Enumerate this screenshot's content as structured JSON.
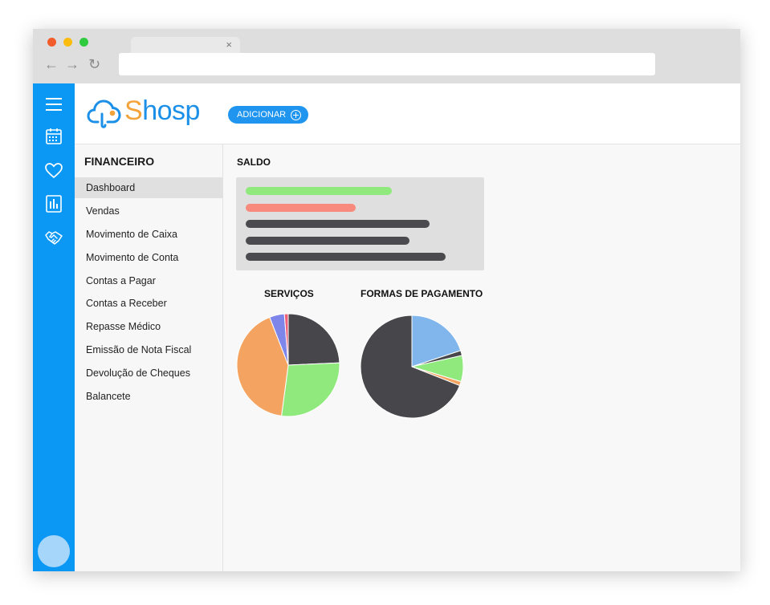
{
  "browser": {
    "tab_close": "×",
    "back": "←",
    "forward": "→",
    "reload": "↻",
    "url": ""
  },
  "rail": {
    "icons": [
      "menu-icon",
      "calendar-icon",
      "heart-icon",
      "chart-icon",
      "handshake-icon"
    ]
  },
  "header": {
    "logo_prefix": "S",
    "logo_rest": "hosp",
    "add_label": "ADICIONAR"
  },
  "sidebar": {
    "title": "FINANCEIRO",
    "items": [
      {
        "label": "Dashboard",
        "active": true
      },
      {
        "label": "Vendas"
      },
      {
        "label": "Movimento de Caixa"
      },
      {
        "label": "Movimento de Conta"
      },
      {
        "label": "Contas a Pagar"
      },
      {
        "label": "Contas a Receber"
      },
      {
        "label": "Repasse Médico"
      },
      {
        "label": "Emissão de Nota Fiscal"
      },
      {
        "label": "Devolução de Cheques"
      },
      {
        "label": "Balancete"
      }
    ]
  },
  "saldo": {
    "title": "SALDO",
    "bars": [
      {
        "color": "#8fe97c",
        "value": 0.73
      },
      {
        "color": "#f78a7c",
        "value": 0.55
      },
      {
        "color": "#4b4b4f",
        "value": 0.92
      },
      {
        "color": "#4b4b4f",
        "value": 0.82
      },
      {
        "color": "#4b4b4f",
        "value": 1.0
      }
    ]
  },
  "colors": {
    "accent": "#0b98f4",
    "logo_blue": "#1c90e8",
    "logo_orange": "#f4a33a"
  },
  "chart_data": [
    {
      "type": "pie",
      "title": "SERVIÇOS",
      "values": [
        24.3,
        27.8,
        42.0,
        4.7,
        1.2
      ],
      "colors": [
        "#46464b",
        "#8fe97c",
        "#f4a460",
        "#7f86ea",
        "#ef5f77"
      ]
    },
    {
      "type": "pie",
      "title": "FORMAS DE PAGAMENTO",
      "values": [
        19.9,
        1.6,
        8.2,
        1.3,
        69.0
      ],
      "colors": [
        "#80b6ec",
        "#46464b",
        "#8fe97c",
        "#f4a460",
        "#46464b"
      ]
    }
  ]
}
